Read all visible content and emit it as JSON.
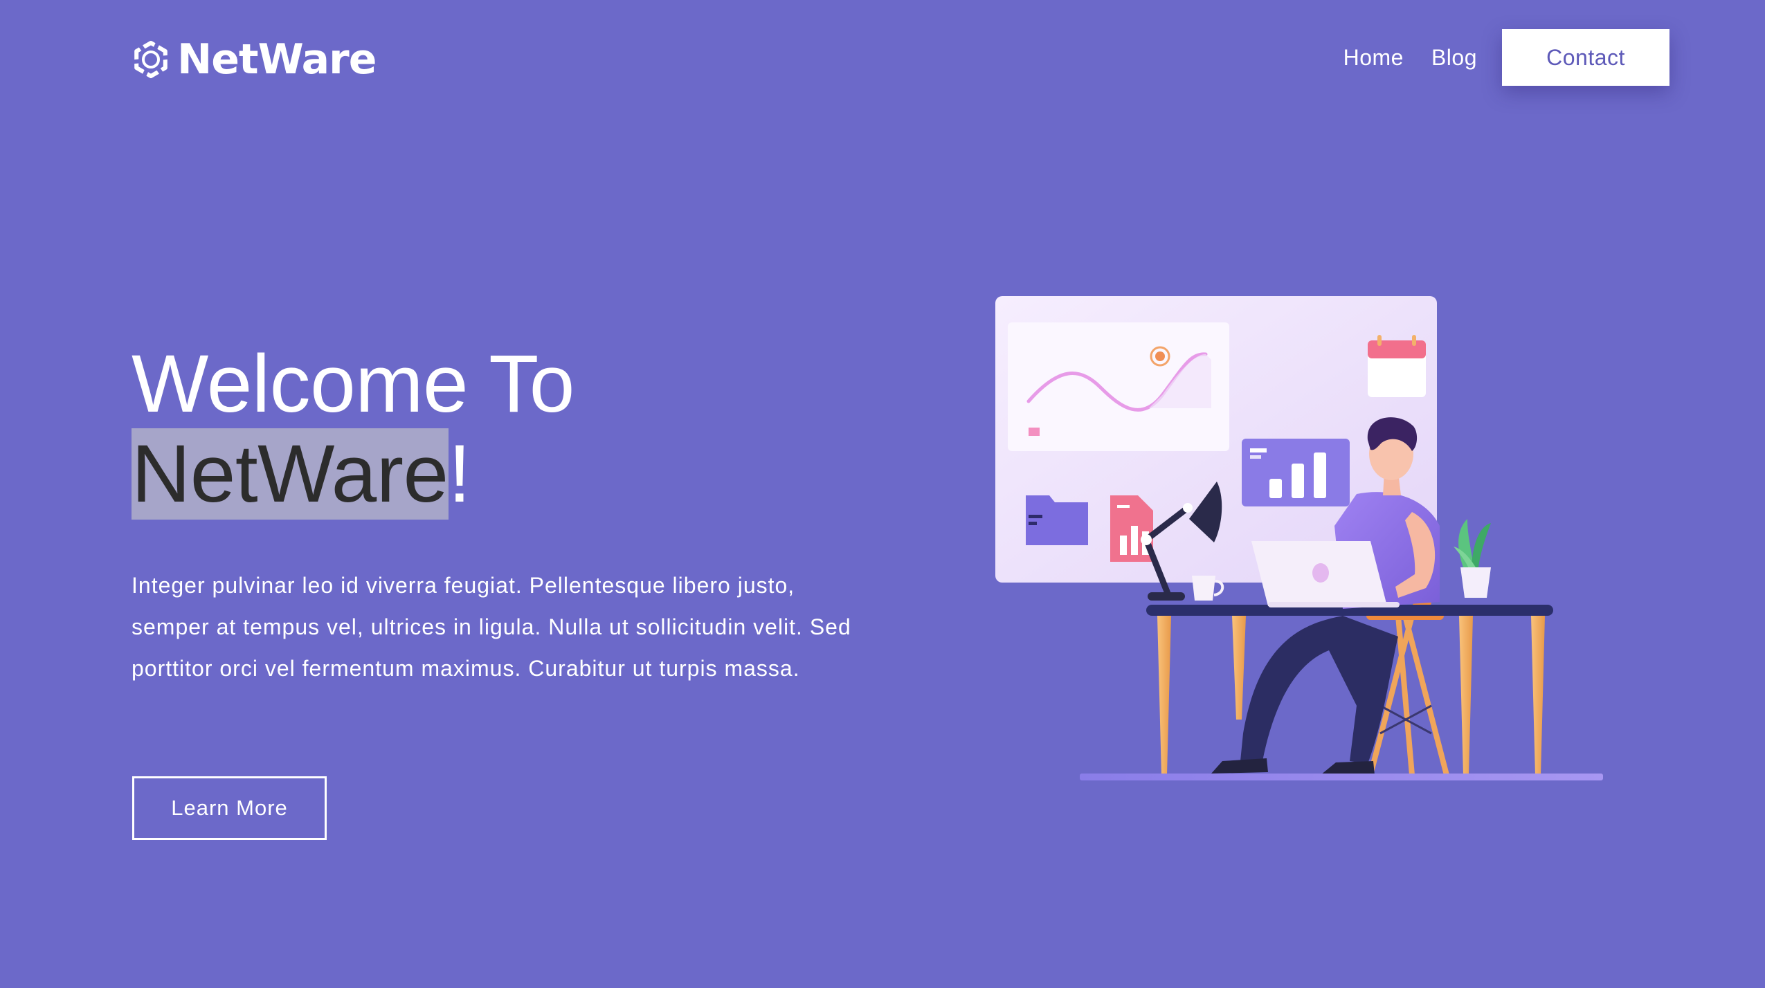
{
  "brand": {
    "name": "NetWare",
    "logo_icon": "aperture-ring-icon"
  },
  "nav": {
    "home_label": "Home",
    "blog_label": "Blog",
    "contact_label": "Contact"
  },
  "hero": {
    "title_line1": "Welcome To",
    "title_highlight": "NetWare",
    "title_suffix": "!",
    "description": "Integer pulvinar leo id viverra feugiat. Pellentesque libero justo, semper at tempus vel, ultrices in ligula. Nulla ut sollicitudin velit. Sed porttitor orci vel fermentum maximus. Curabitur ut turpis massa.",
    "cta_label": "Learn More",
    "illustration_icon": "person-at-desk-illustration"
  },
  "colors": {
    "background": "#6c69c9",
    "text": "#ffffff",
    "highlight_bg": "#a6a5c9",
    "highlight_text": "#2c2c2c",
    "contact_text": "#5d59b8"
  }
}
